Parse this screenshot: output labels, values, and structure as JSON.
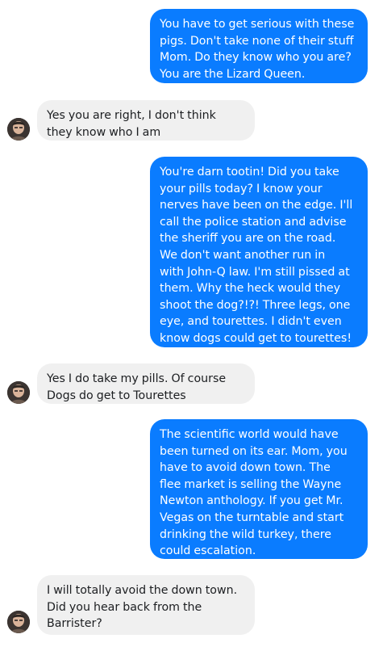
{
  "messages": [
    {
      "sender": "me",
      "text": "You have to get serious with these\npigs. Don't take none of their stuff\nMom. Do they know who you are?\nYou are the Lizard Queen."
    },
    {
      "sender": "mom",
      "text": "Yes you are right, I don't think\nthey know who I am"
    },
    {
      "sender": "me",
      "text": "You're darn tootin! Did you take\nyour pills today? I know your\nnerves have been on the edge. I'll\ncall the police station and advise\nthe sheriff you are on the road.\nWe don't want another run in\nwith John-Q law. I'm still pissed at\nthem. Why the heck would they\nshoot the dog?!?! Three legs, one\neye, and tourettes. I didn't even\nknow dogs could get to tourettes!"
    },
    {
      "sender": "mom",
      "text": "Yes I do take my pills. Of course\nDogs do get to Tourettes"
    },
    {
      "sender": "me",
      "text": "The scientific world would have\nbeen turned on its ear. Mom, you\nhave to avoid down town. The\nflee market is selling the Wayne\nNewton anthology. If you get Mr.\nVegas on the turntable and start\ndrinking the wild turkey, there\ncould escalation."
    },
    {
      "sender": "mom",
      "text": "I will totally avoid the down town.\nDid you hear back from the\nBarrister?"
    }
  ],
  "colors": {
    "outgoing_bubble": "#0a7cff",
    "outgoing_text": "#ffffff",
    "incoming_bubble": "#f0f0f0",
    "incoming_text": "#1c1e21"
  },
  "icons": {
    "avatar": "contact-avatar-photo"
  }
}
